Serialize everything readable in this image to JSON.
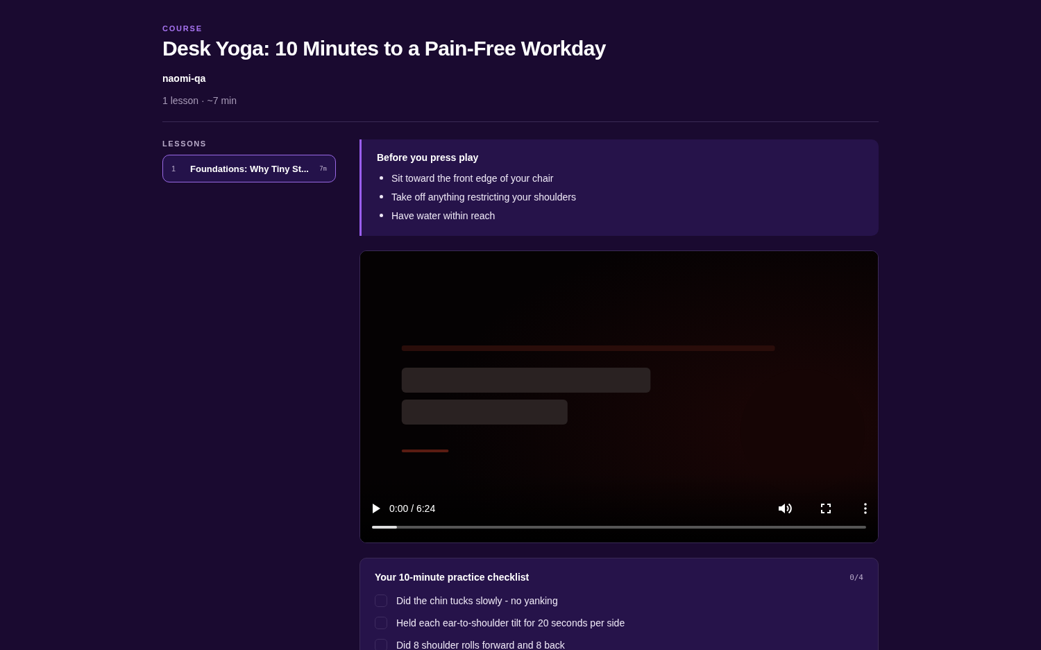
{
  "header": {
    "eyebrow": "COURSE",
    "title": "Desk Yoga: 10 Minutes to a Pain-Free Workday",
    "author": "naomi-qa",
    "meta": "1 lesson · ~7 min"
  },
  "sidebar": {
    "heading": "LESSONS",
    "items": [
      {
        "number": "1",
        "title": "Foundations: Why Tiny St...",
        "duration": "7m",
        "selected": true
      }
    ]
  },
  "callout": {
    "title": "Before you press play",
    "items": [
      "Sit toward the front edge of your chair",
      "Take off anything restricting your shoulders",
      "Have water within reach"
    ]
  },
  "video": {
    "time": "0:00 / 6:24",
    "playing": false,
    "progress": {
      "level": 0.05
    }
  },
  "checklist": {
    "title": "Your 10-minute practice checklist",
    "count": "0/4",
    "items": [
      {
        "label": "Did the chin tucks slowly - no yanking",
        "checked": false
      },
      {
        "label": "Held each ear-to-shoulder tilt for 20 seconds per side",
        "checked": false
      },
      {
        "label": "Did 8 shoulder rolls forward and 8 back",
        "checked": false
      }
    ]
  }
}
